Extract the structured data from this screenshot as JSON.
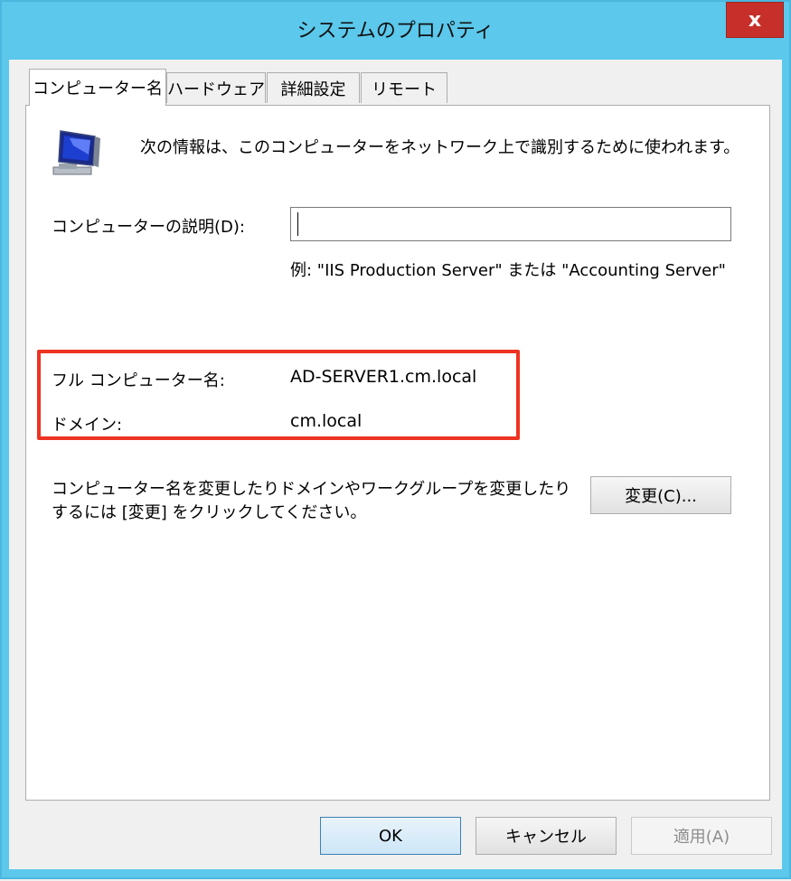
{
  "window": {
    "title": "システムのプロパティ",
    "close_label": "x"
  },
  "tabs": [
    {
      "label": "コンピューター名",
      "active": true
    },
    {
      "label": "ハードウェア",
      "active": false
    },
    {
      "label": "詳細設定",
      "active": false
    },
    {
      "label": "リモート",
      "active": false
    }
  ],
  "computer_name_tab": {
    "intro": "次の情報は、このコンピューターをネットワーク上で識別するために使われます。",
    "description_label": "コンピューターの説明(D):",
    "description_value": "",
    "example_text": "例: \"IIS Production Server\" または \"Accounting Server\"",
    "full_name_label": "フル コンピューター名:",
    "full_name_value": "AD-SERVER1.cm.local",
    "domain_label": "ドメイン:",
    "domain_value": "cm.local",
    "change_instructions": "コンピューター名を変更したりドメインやワークグループを変更したりするには [変更] をクリックしてください。",
    "change_button": "変更(C)..."
  },
  "footer": {
    "ok_label": "OK",
    "cancel_label": "キャンセル",
    "apply_label": "適用(A)"
  },
  "colors": {
    "title_bar": "#5bc8ec",
    "close_button": "#c7302a",
    "highlight_box": "#ee3322"
  },
  "icons": {
    "computer": "computer-icon"
  }
}
